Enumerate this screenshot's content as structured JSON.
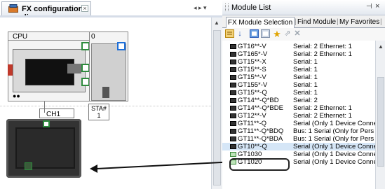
{
  "diagram_tab": {
    "title": "FX configuration diagram",
    "close": "×",
    "icon": "diagram-icon"
  },
  "diagram_nav": "◂ ▸ ▾",
  "plc": {
    "cpu_label": "CPU",
    "leds": "●●",
    "slot_number": "0",
    "station_label": "STA#",
    "station_number": "1"
  },
  "hmi": {
    "channel_label": "CH1"
  },
  "module_list": {
    "title": "Module List",
    "pin_icon": "pin-icon",
    "close_icon": "close-icon",
    "pin": "⊣",
    "close": "×",
    "tabs": [
      {
        "label": "FX Module Selection"
      },
      {
        "label": "Find Module"
      },
      {
        "label": "My Favorites"
      }
    ],
    "toolbar_icons": [
      "category-view-icon",
      "sort-icon",
      "expand-icon",
      "collapse-icon",
      "favorite-star-icon",
      "add-favorite-icon",
      "delete-icon"
    ],
    "rows": [
      {
        "model": "GT16**-V",
        "desc": "Serial: 2 Ethernet: 1",
        "icon": "dark"
      },
      {
        "model": "GT165*-V",
        "desc": "Serial: 2 Ethernet: 1",
        "icon": "dark"
      },
      {
        "model": "GT15**-X",
        "desc": "Serial: 1",
        "icon": "dark"
      },
      {
        "model": "GT15**-S",
        "desc": "Serial: 1",
        "icon": "dark"
      },
      {
        "model": "GT15**-V",
        "desc": "Serial: 1",
        "icon": "dark"
      },
      {
        "model": "GT155*-V",
        "desc": "Serial: 1",
        "icon": "dark"
      },
      {
        "model": "GT15**-Q",
        "desc": "Serial: 1",
        "icon": "dark"
      },
      {
        "model": "GT14**-Q*BD",
        "desc": "Serial: 2",
        "icon": "dark"
      },
      {
        "model": "GT14**-Q*BDE",
        "desc": "Serial: 2 Ethernet: 1",
        "icon": "dark"
      },
      {
        "model": "GT12**-V",
        "desc": "Serial: 2 Ethernet: 1",
        "icon": "dark"
      },
      {
        "model": "GT11**-Q",
        "desc": "Serial (Only 1 Device Conne",
        "icon": "dark"
      },
      {
        "model": "GT11**-Q*BDQ",
        "desc": "Bus: 1 Serial (Only for Pers",
        "icon": "dark"
      },
      {
        "model": "GT11**-Q*BDA",
        "desc": "Bus: 1 Serial (Only for Pers",
        "icon": "dark"
      },
      {
        "model": "GT10**-Q",
        "desc": "Serial (Only 1 Device Conne",
        "icon": "dark",
        "selected": true
      },
      {
        "model": "GT1030",
        "desc": "Serial (Only 1 Device Conne",
        "icon": "green"
      },
      {
        "model": "GT1020",
        "desc": "Serial (Only 1 Device Conne",
        "icon": "green"
      }
    ]
  }
}
